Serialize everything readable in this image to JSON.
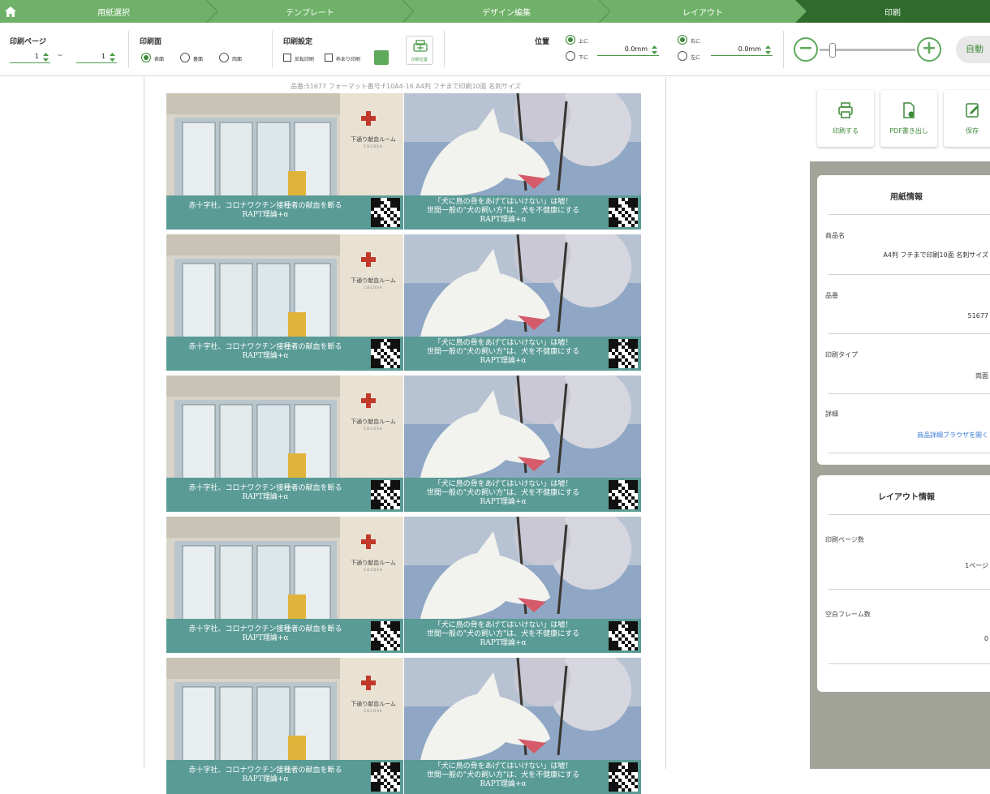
{
  "steps": [
    {
      "label": "用紙選択"
    },
    {
      "label": "テンプレート"
    },
    {
      "label": "デザイン編集"
    },
    {
      "label": "レイアウト"
    },
    {
      "label": "印刷"
    }
  ],
  "toolbar": {
    "print_pages": {
      "label": "印刷ページ",
      "from": "1",
      "tilde": "~",
      "to": "1"
    },
    "print_side": {
      "label": "印刷面",
      "options": [
        "表面",
        "裏面",
        "両面"
      ],
      "selected": "表面"
    },
    "print_settings": {
      "label": "印刷設定",
      "reverse": "反転印刷",
      "frame": "枠あり印刷",
      "pos_button": "印刷位置"
    },
    "position": {
      "label": "位置",
      "up": "上に",
      "down": "下に",
      "vertical_value": "0.0mm",
      "right": "右に",
      "left": "左に",
      "horizontal_value": "0.0mm"
    },
    "zoom": {
      "minus": "−",
      "plus": "+",
      "auto": "自動"
    }
  },
  "sheet": {
    "caption": "品番:51677 フォーマット番号:F10A4-16 A4判 フチまで印刷10面 名刺サイズ",
    "card_left": {
      "line1": "赤十字社、コロナワクチン接種者の献血を断る",
      "line2": "RAPT理論+α",
      "sign": "下通り献血ルーム",
      "sign_sub": "COCOSA"
    },
    "card_right": {
      "line1": "「犬に鳥の骨をあげてはいけない」は嘘！",
      "line2": "世間一般の\"犬の飼い方\"は、犬を不健康にする",
      "line3": "RAPT理論+α"
    },
    "rows": 5
  },
  "actions": [
    {
      "label": "印刷する",
      "icon": "printer-icon"
    },
    {
      "label": "PDF書き出し",
      "icon": "pdf-export-icon"
    },
    {
      "label": "保存",
      "icon": "save-icon"
    }
  ],
  "paper_info": {
    "title": "用紙情報",
    "product_name_label": "商品名",
    "product_name": "A4判 フチまで印刷10面 名刺サイズ",
    "product_no_label": "品番",
    "product_no": "51677",
    "print_type_label": "印刷タイプ",
    "print_type": "両面",
    "detail_label": "詳細",
    "detail_link": "商品詳細ブラウザを開く"
  },
  "layout_info": {
    "title": "レイアウト情報",
    "pages_label": "印刷ページ数",
    "pages": "1ページ",
    "blank_label": "空白フレーム数",
    "blank": "0"
  },
  "colors": {
    "accent": "#6fb168",
    "active_step": "#2e6b2c",
    "banner": "#5a9b95",
    "panel_bg": "#a2a49a"
  }
}
